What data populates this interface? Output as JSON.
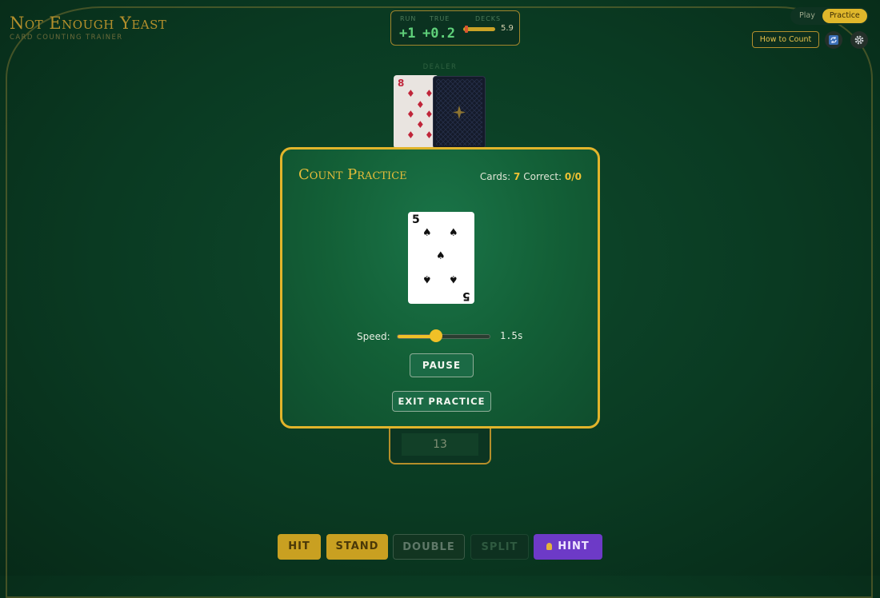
{
  "app": {
    "title": "Not Enough Yeast",
    "subtitle": "CARD COUNTING TRAINER"
  },
  "counts": {
    "run_label": "RUN",
    "run_value": "+1",
    "true_label": "TRUE",
    "true_value": "+0.2",
    "decks_label": "DECKS",
    "decks_value": "5.9"
  },
  "mode": {
    "play_label": "Play",
    "practice_label": "Practice",
    "active": "Practice"
  },
  "toolbar": {
    "how_to_label": "How to Count"
  },
  "table": {
    "dealer_label": "DEALER",
    "dealer_upcard_rank": "8",
    "dealer_upcard_suit": "♦",
    "player_total": "13"
  },
  "actions": {
    "hit": "HIT",
    "stand": "STAND",
    "double": "DOUBLE",
    "split": "SPLIT",
    "hint": "HINT"
  },
  "modal": {
    "title": "Count Practice",
    "cards_label": "Cards:",
    "cards_value": "7",
    "correct_label": "Correct:",
    "correct_value": "0/0",
    "card_rank": "5",
    "card_suit": "♠",
    "speed_label": "Speed:",
    "speed_value": "1.5s",
    "speed_fraction": 0.42,
    "pause_label": "PAUSE",
    "exit_label": "EXIT PRACTICE"
  },
  "colors": {
    "accent": "#e1b42b",
    "felt": "#0a3a22",
    "hint": "#6d3ac7"
  }
}
